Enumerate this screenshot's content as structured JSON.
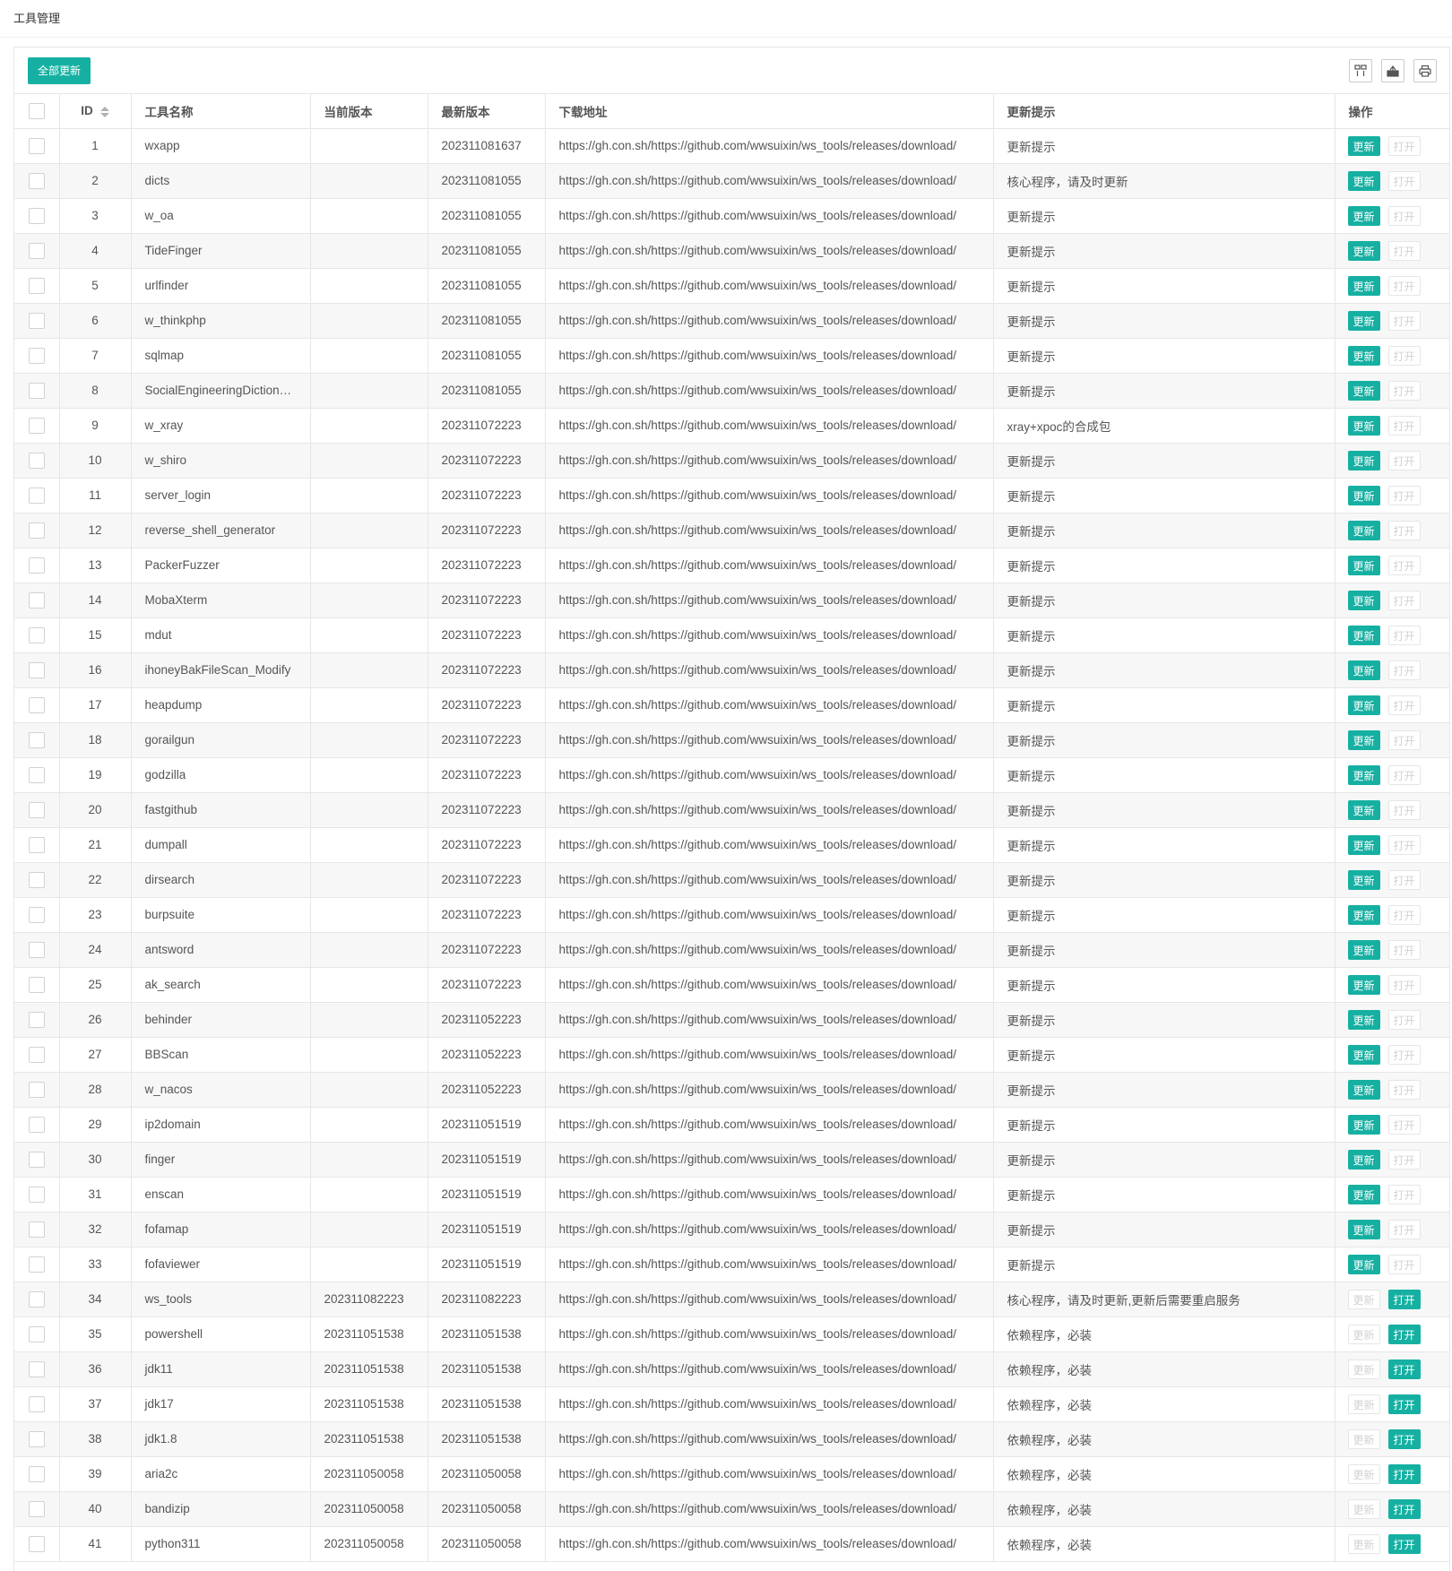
{
  "page": {
    "title": "工具管理"
  },
  "toolbar": {
    "update_all_label": "全部更新"
  },
  "table": {
    "headers": [
      "ID",
      "工具名称",
      "当前版本",
      "最新版本",
      "下载地址",
      "更新提示",
      "操作"
    ],
    "update_label": "更新",
    "open_label": "打开",
    "rows": [
      {
        "id": "1",
        "name": "wxapp",
        "current": "",
        "latest": "202311081637",
        "url": "https://gh.con.sh/https://github.com/wwsuixin/ws_tools/releases/download/",
        "tip": "更新提示",
        "installed": false
      },
      {
        "id": "2",
        "name": "dicts",
        "current": "",
        "latest": "202311081055",
        "url": "https://gh.con.sh/https://github.com/wwsuixin/ws_tools/releases/download/",
        "tip": "核心程序，请及时更新",
        "installed": false
      },
      {
        "id": "3",
        "name": "w_oa",
        "current": "",
        "latest": "202311081055",
        "url": "https://gh.con.sh/https://github.com/wwsuixin/ws_tools/releases/download/",
        "tip": "更新提示",
        "installed": false
      },
      {
        "id": "4",
        "name": "TideFinger",
        "current": "",
        "latest": "202311081055",
        "url": "https://gh.con.sh/https://github.com/wwsuixin/ws_tools/releases/download/",
        "tip": "更新提示",
        "installed": false
      },
      {
        "id": "5",
        "name": "urlfinder",
        "current": "",
        "latest": "202311081055",
        "url": "https://gh.con.sh/https://github.com/wwsuixin/ws_tools/releases/download/",
        "tip": "更新提示",
        "installed": false
      },
      {
        "id": "6",
        "name": "w_thinkphp",
        "current": "",
        "latest": "202311081055",
        "url": "https://gh.con.sh/https://github.com/wwsuixin/ws_tools/releases/download/",
        "tip": "更新提示",
        "installed": false
      },
      {
        "id": "7",
        "name": "sqlmap",
        "current": "",
        "latest": "202311081055",
        "url": "https://gh.con.sh/https://github.com/wwsuixin/ws_tools/releases/download/",
        "tip": "更新提示",
        "installed": false
      },
      {
        "id": "8",
        "name": "SocialEngineeringDictionaryGenerator",
        "current": "",
        "latest": "202311081055",
        "url": "https://gh.con.sh/https://github.com/wwsuixin/ws_tools/releases/download/",
        "tip": "更新提示",
        "installed": false
      },
      {
        "id": "9",
        "name": "w_xray",
        "current": "",
        "latest": "202311072223",
        "url": "https://gh.con.sh/https://github.com/wwsuixin/ws_tools/releases/download/",
        "tip": "xray+xpoc的合成包",
        "installed": false
      },
      {
        "id": "10",
        "name": "w_shiro",
        "current": "",
        "latest": "202311072223",
        "url": "https://gh.con.sh/https://github.com/wwsuixin/ws_tools/releases/download/",
        "tip": "更新提示",
        "installed": false
      },
      {
        "id": "11",
        "name": "server_login",
        "current": "",
        "latest": "202311072223",
        "url": "https://gh.con.sh/https://github.com/wwsuixin/ws_tools/releases/download/",
        "tip": "更新提示",
        "installed": false
      },
      {
        "id": "12",
        "name": "reverse_shell_generator",
        "current": "",
        "latest": "202311072223",
        "url": "https://gh.con.sh/https://github.com/wwsuixin/ws_tools/releases/download/",
        "tip": "更新提示",
        "installed": false
      },
      {
        "id": "13",
        "name": "PackerFuzzer",
        "current": "",
        "latest": "202311072223",
        "url": "https://gh.con.sh/https://github.com/wwsuixin/ws_tools/releases/download/",
        "tip": "更新提示",
        "installed": false
      },
      {
        "id": "14",
        "name": "MobaXterm",
        "current": "",
        "latest": "202311072223",
        "url": "https://gh.con.sh/https://github.com/wwsuixin/ws_tools/releases/download/",
        "tip": "更新提示",
        "installed": false
      },
      {
        "id": "15",
        "name": "mdut",
        "current": "",
        "latest": "202311072223",
        "url": "https://gh.con.sh/https://github.com/wwsuixin/ws_tools/releases/download/",
        "tip": "更新提示",
        "installed": false
      },
      {
        "id": "16",
        "name": "ihoneyBakFileScan_Modify",
        "current": "",
        "latest": "202311072223",
        "url": "https://gh.con.sh/https://github.com/wwsuixin/ws_tools/releases/download/",
        "tip": "更新提示",
        "installed": false
      },
      {
        "id": "17",
        "name": "heapdump",
        "current": "",
        "latest": "202311072223",
        "url": "https://gh.con.sh/https://github.com/wwsuixin/ws_tools/releases/download/",
        "tip": "更新提示",
        "installed": false
      },
      {
        "id": "18",
        "name": "gorailgun",
        "current": "",
        "latest": "202311072223",
        "url": "https://gh.con.sh/https://github.com/wwsuixin/ws_tools/releases/download/",
        "tip": "更新提示",
        "installed": false
      },
      {
        "id": "19",
        "name": "godzilla",
        "current": "",
        "latest": "202311072223",
        "url": "https://gh.con.sh/https://github.com/wwsuixin/ws_tools/releases/download/",
        "tip": "更新提示",
        "installed": false
      },
      {
        "id": "20",
        "name": "fastgithub",
        "current": "",
        "latest": "202311072223",
        "url": "https://gh.con.sh/https://github.com/wwsuixin/ws_tools/releases/download/",
        "tip": "更新提示",
        "installed": false
      },
      {
        "id": "21",
        "name": "dumpall",
        "current": "",
        "latest": "202311072223",
        "url": "https://gh.con.sh/https://github.com/wwsuixin/ws_tools/releases/download/",
        "tip": "更新提示",
        "installed": false
      },
      {
        "id": "22",
        "name": "dirsearch",
        "current": "",
        "latest": "202311072223",
        "url": "https://gh.con.sh/https://github.com/wwsuixin/ws_tools/releases/download/",
        "tip": "更新提示",
        "installed": false
      },
      {
        "id": "23",
        "name": "burpsuite",
        "current": "",
        "latest": "202311072223",
        "url": "https://gh.con.sh/https://github.com/wwsuixin/ws_tools/releases/download/",
        "tip": "更新提示",
        "installed": false
      },
      {
        "id": "24",
        "name": "antsword",
        "current": "",
        "latest": "202311072223",
        "url": "https://gh.con.sh/https://github.com/wwsuixin/ws_tools/releases/download/",
        "tip": "更新提示",
        "installed": false
      },
      {
        "id": "25",
        "name": "ak_search",
        "current": "",
        "latest": "202311072223",
        "url": "https://gh.con.sh/https://github.com/wwsuixin/ws_tools/releases/download/",
        "tip": "更新提示",
        "installed": false
      },
      {
        "id": "26",
        "name": "behinder",
        "current": "",
        "latest": "202311052223",
        "url": "https://gh.con.sh/https://github.com/wwsuixin/ws_tools/releases/download/",
        "tip": "更新提示",
        "installed": false
      },
      {
        "id": "27",
        "name": "BBScan",
        "current": "",
        "latest": "202311052223",
        "url": "https://gh.con.sh/https://github.com/wwsuixin/ws_tools/releases/download/",
        "tip": "更新提示",
        "installed": false
      },
      {
        "id": "28",
        "name": "w_nacos",
        "current": "",
        "latest": "202311052223",
        "url": "https://gh.con.sh/https://github.com/wwsuixin/ws_tools/releases/download/",
        "tip": "更新提示",
        "installed": false
      },
      {
        "id": "29",
        "name": "ip2domain",
        "current": "",
        "latest": "202311051519",
        "url": "https://gh.con.sh/https://github.com/wwsuixin/ws_tools/releases/download/",
        "tip": "更新提示",
        "installed": false
      },
      {
        "id": "30",
        "name": "finger",
        "current": "",
        "latest": "202311051519",
        "url": "https://gh.con.sh/https://github.com/wwsuixin/ws_tools/releases/download/",
        "tip": "更新提示",
        "installed": false
      },
      {
        "id": "31",
        "name": "enscan",
        "current": "",
        "latest": "202311051519",
        "url": "https://gh.con.sh/https://github.com/wwsuixin/ws_tools/releases/download/",
        "tip": "更新提示",
        "installed": false
      },
      {
        "id": "32",
        "name": "fofamap",
        "current": "",
        "latest": "202311051519",
        "url": "https://gh.con.sh/https://github.com/wwsuixin/ws_tools/releases/download/",
        "tip": "更新提示",
        "installed": false
      },
      {
        "id": "33",
        "name": "fofaviewer",
        "current": "",
        "latest": "202311051519",
        "url": "https://gh.con.sh/https://github.com/wwsuixin/ws_tools/releases/download/",
        "tip": "更新提示",
        "installed": false
      },
      {
        "id": "34",
        "name": "ws_tools",
        "current": "202311082223",
        "latest": "202311082223",
        "url": "https://gh.con.sh/https://github.com/wwsuixin/ws_tools/releases/download/",
        "tip": "核心程序，请及时更新,更新后需要重启服务",
        "installed": true
      },
      {
        "id": "35",
        "name": "powershell",
        "current": "202311051538",
        "latest": "202311051538",
        "url": "https://gh.con.sh/https://github.com/wwsuixin/ws_tools/releases/download/",
        "tip": "依赖程序，必装",
        "installed": true
      },
      {
        "id": "36",
        "name": "jdk11",
        "current": "202311051538",
        "latest": "202311051538",
        "url": "https://gh.con.sh/https://github.com/wwsuixin/ws_tools/releases/download/",
        "tip": "依赖程序，必装",
        "installed": true
      },
      {
        "id": "37",
        "name": "jdk17",
        "current": "202311051538",
        "latest": "202311051538",
        "url": "https://gh.con.sh/https://github.com/wwsuixin/ws_tools/releases/download/",
        "tip": "依赖程序，必装",
        "installed": true
      },
      {
        "id": "38",
        "name": "jdk1.8",
        "current": "202311051538",
        "latest": "202311051538",
        "url": "https://gh.con.sh/https://github.com/wwsuixin/ws_tools/releases/download/",
        "tip": "依赖程序，必装",
        "installed": true
      },
      {
        "id": "39",
        "name": "aria2c",
        "current": "202311050058",
        "latest": "202311050058",
        "url": "https://gh.con.sh/https://github.com/wwsuixin/ws_tools/releases/download/",
        "tip": "依赖程序，必装",
        "installed": true
      },
      {
        "id": "40",
        "name": "bandizip",
        "current": "202311050058",
        "latest": "202311050058",
        "url": "https://gh.con.sh/https://github.com/wwsuixin/ws_tools/releases/download/",
        "tip": "依赖程序，必装",
        "installed": true
      },
      {
        "id": "41",
        "name": "python311",
        "current": "202311050058",
        "latest": "202311050058",
        "url": "https://gh.con.sh/https://github.com/wwsuixin/ws_tools/releases/download/",
        "tip": "依赖程序，必装",
        "installed": true
      }
    ]
  },
  "icons": {
    "columns": "columns-icon",
    "export": "export-icon",
    "print": "print-icon",
    "sort": "sort-icon",
    "checkbox": "checkbox-icon"
  },
  "colors": {
    "accent": "#16b0a2",
    "disabled_text": "#d2d2d2",
    "border": "#e6e6e6",
    "stripe": "#f7f7f7"
  }
}
